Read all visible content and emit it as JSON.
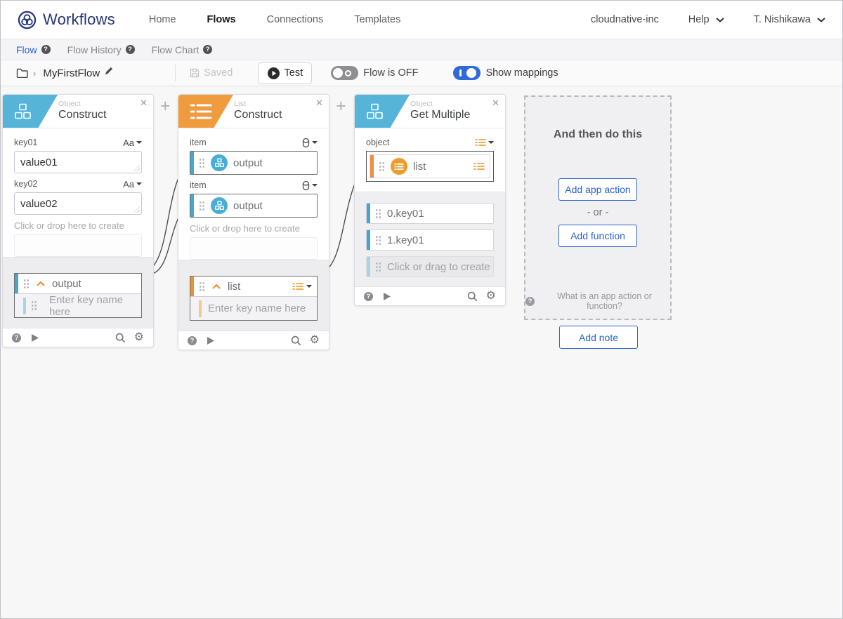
{
  "colors": {
    "accent_blue": "#2c62d0",
    "header_blue": "#55b4d8",
    "header_orange": "#f09b3d",
    "toggle_on_blue": "#2e6bd8",
    "brand_navy": "#26357c"
  },
  "nav": {
    "brand": "Workflows",
    "items": [
      {
        "label": "Home"
      },
      {
        "label": "Flows"
      },
      {
        "label": "Connections"
      },
      {
        "label": "Templates"
      }
    ],
    "org": "cloudnative-inc",
    "help": "Help",
    "user": "T. Nishikawa"
  },
  "tabs": [
    {
      "label": "Flow"
    },
    {
      "label": "Flow History"
    },
    {
      "label": "Flow Chart"
    }
  ],
  "toolbar": {
    "flow_name": "MyFirstFlow",
    "saved_label": "Saved",
    "test_label": "Test",
    "flow_toggle_label": "Flow is OFF",
    "mappings_toggle_label": "Show mappings"
  },
  "cards": [
    {
      "type_label": "Object",
      "title": "Construct",
      "fields": [
        {
          "label": "key01",
          "type": "Aa",
          "value": "value01"
        },
        {
          "label": "key02",
          "type": "Aa",
          "value": "value02"
        }
      ],
      "drop_hint": "Click or drop here to create",
      "output_name": "output",
      "output_placeholder": "Enter key name here"
    },
    {
      "type_label": "List",
      "title": "Construct",
      "items": [
        {
          "label": "item",
          "value": "output"
        },
        {
          "label": "item",
          "value": "output"
        }
      ],
      "drop_hint": "Click or drop here to create",
      "output_name": "list",
      "output_placeholder": "Enter key name here"
    },
    {
      "type_label": "Object",
      "title": "Get Multiple",
      "object_label": "object",
      "object_value": "list",
      "rows": [
        "0.key01",
        "1.key01"
      ],
      "drag_hint": "Click or drag to create"
    }
  ],
  "next_panel": {
    "title": "And then do this",
    "add_app_action": "Add app action",
    "or": "- or -",
    "add_function": "Add function",
    "hint": "What is an app action or function?",
    "add_note": "Add note"
  }
}
